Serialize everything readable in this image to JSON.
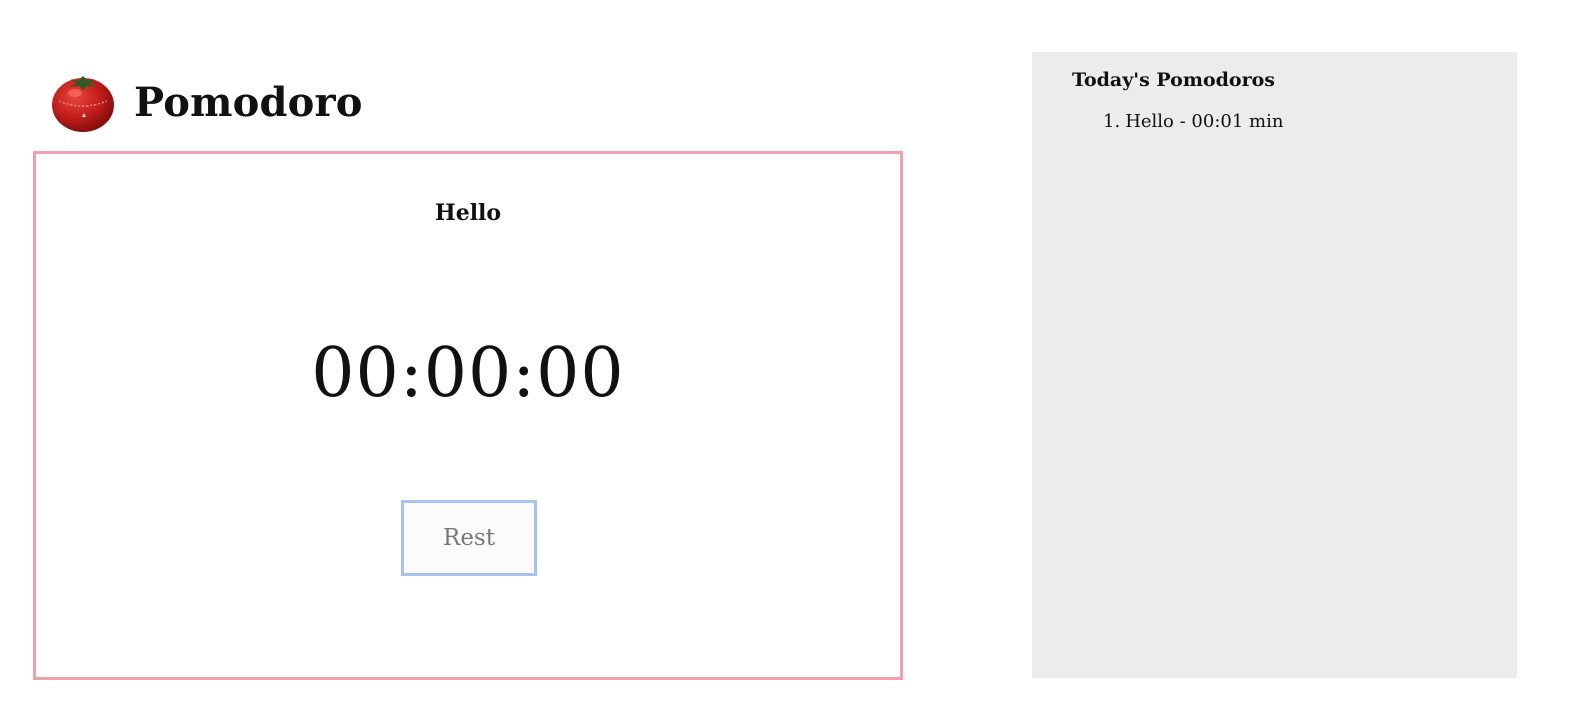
{
  "app": {
    "title": "Pomodoro",
    "logo_icon": "tomato-timer-icon"
  },
  "timer": {
    "task_name": "Hello",
    "time": "00:00:00",
    "rest_button_label": "Rest",
    "card_border_color": "#f2a0ab",
    "button_border_color": "#a9c3f1"
  },
  "sidebar": {
    "title": "Today's Pomodoros",
    "background_color": "#ececec",
    "items": [
      {
        "number": "1.",
        "text": "Hello - 00:01 min"
      }
    ]
  }
}
